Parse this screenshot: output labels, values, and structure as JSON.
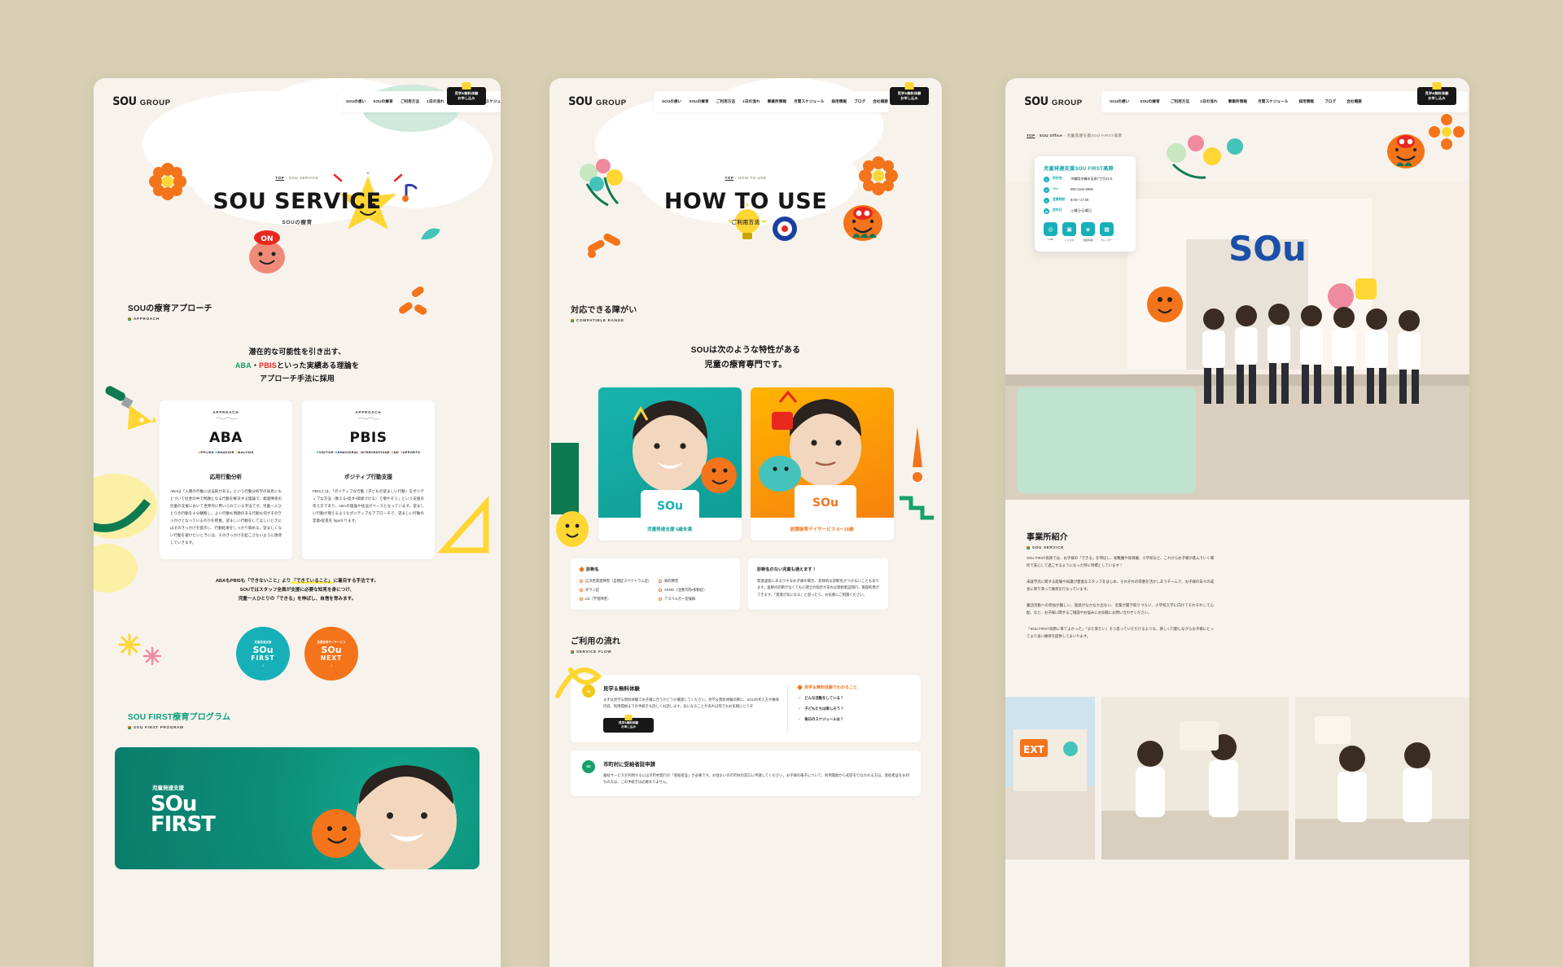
{
  "brand": {
    "name": "SOU",
    "suffix": "GROUP"
  },
  "nav": {
    "items": [
      "SOUの想い",
      "SOUの療育",
      "ご利用方法",
      "1日の流れ",
      "事業所情報",
      "月間スケジュール",
      "採用情報",
      "ブログ",
      "会社概要"
    ],
    "cta_line1": "見学&無料体験",
    "cta_line2": "お申し込み"
  },
  "panel1": {
    "breadcrumb": {
      "top": "TOP",
      "sep": "›",
      "current": "SOU SERVICE"
    },
    "hero": {
      "title": "SOU SERVICE",
      "subtitle": "SOUの療育"
    },
    "section": {
      "title": "SOUの療育アプローチ",
      "en": "APPROACH"
    },
    "lead": {
      "line1": "潜在的な可能性を引き出す、",
      "line2_aba": "ABA",
      "line2_mid": "・",
      "line2_pbis": "PBIS",
      "line2_rest": "といった実績ある理論を",
      "line3": "アプローチ手法に採用"
    },
    "cards": [
      {
        "label": "APPROACH",
        "big": "ABA",
        "sub_parts": [
          "A",
          "PPLIED ",
          "B",
          "EHAVIOR ",
          "A",
          "NALYSIS"
        ],
        "title": "応用行動分析",
        "body": "ABAは「人間の行動には法則がある」という行動分析学の知見にもとづいて社会の中で問題となる行動を解決する理論で、発達障害の児童の支援において世界的に用いられている手法です。児童一人ひとりの行動を十分観察し、よい行動も問題のある行動も何がそのきっかけとなっているのかを把握。望ましい行動をしてほしいときにはそのきっかけを提示し、行動結果をしっかり褒める。望ましくない行動を避けたいときには、そのきっかけを起こさないように誘導していきます。"
      },
      {
        "label": "APPROACH",
        "big": "PBIS",
        "sub_parts": [
          "P",
          "OSITIVE ",
          "B",
          "EHAVIORAL ",
          "I",
          "NTERVENTIONS ",
          "A",
          "ND ",
          "S",
          "UPPORTS"
        ],
        "title": "ポジティブ行動支援",
        "body": "PBISとは、「ポジティブな行動（子どもの望ましい行動）をポジティブな方法（教える・促す・価値づける）で増やそう」という支援の考え方であり、ABAの理論や技法がベースとなっています。望ましい行動が増えるようなポジティブなアプローチで、望ましい行動の定着・促進を figurd ります。"
      }
    ],
    "closing": {
      "line1_a": "ABAもPBISも「できないこと」より",
      "line1_mark": "「できていること」",
      "line1_b": "に着目する手法です。",
      "line2": "SOUではスタッフ全員が支援に必要な知見を身につけ、",
      "line3": "児童一人ひとりの「できる」を伸ばし、自信を育みます。"
    },
    "circles": [
      {
        "cap": "児童発達支援",
        "name": "SOu",
        "name2": "FIRST",
        "arrow": "↓",
        "color": "#17b0b8"
      },
      {
        "cap": "放課後等デイサービス",
        "name": "SOu",
        "name2": "NEXT",
        "arrow": "↓",
        "color": "#f4741b"
      }
    ],
    "program": {
      "title": "SOU FIRST療育プログラム",
      "en": "SOU FIRST PROGRAM",
      "banner_small": "児童発達支援",
      "banner_big": "SOu",
      "banner_big2": "FIRST"
    }
  },
  "panel2": {
    "breadcrumb": {
      "top": "TOP",
      "sep": "›",
      "current": "HOW TO USE"
    },
    "hero": {
      "title": "HOW TO USE",
      "subtitle": "ご利用方法"
    },
    "section": {
      "title": "対応できる障がい",
      "en": "COMPATIBLE RANGE"
    },
    "lead": {
      "line1": "SOUは次のような特性がある",
      "line2": "児童の療育専門です。"
    },
    "photo_cards": [
      {
        "caption": "児童発達支援 6歳未満",
        "color": "teal"
      },
      {
        "caption": "放課後等デイサービス 6〜18歳",
        "color": "orange"
      }
    ],
    "diagnosis": {
      "heading": "診断名",
      "items": [
        "広汎性発達障害（自閉症スペクトラム症）",
        "知的障害",
        "ダウン症",
        "ADHD（注意欠陥・多動症）",
        "LD（学習障害）",
        "アスペルガー症候群"
      ]
    },
    "note": {
      "heading": "診断名のない児童も通えます！",
      "body": "発達過程にあるウチなお子様の場合、具体的な診断名がつかないこともあります。医師の診断がなくても心理士の指示があれば受給者証発行、施設利用ができます。「発達が気になる」と思ったら、お気軽にご相談ください。"
    },
    "flow_section": {
      "title": "ご利用の流れ",
      "en": "SERVICE FLOW"
    },
    "flow": [
      {
        "num": "01",
        "title": "見学＆無料体験",
        "body": "まずは見学＆無料体験でお子様に合うかどうか確認してください。見学＆無料体験の際に、SOUの考え方や療育内容、利用開始までの手続きも詳しくお話します。気になることがあれば何でもお気軽にどうぞ",
        "btn1": "見学&無料体験",
        "btn2": "お申し込み",
        "side_heading": "見学＆無料体験でわかること",
        "side_items": [
          "どんな活動をしている？",
          "子どもたちは楽しそう？",
          "毎日のスケジュールは？"
        ]
      },
      {
        "num": "02",
        "title": "市町村に受給者証申請",
        "body": "福祉サービスを利用するには市町村発行の「受給者証」が必要です。お住まいの市町村の窓口に申請してください。お子様の様子について、利用開始から初診を行なわれる方は、受給者証をお持ちの方は、この手続きは必要ありません。",
        "side_heading": "",
        "side_items": []
      }
    ]
  },
  "panel3": {
    "breadcrumb": {
      "top": "TOP",
      "sep": "›",
      "mid": "SOU Office",
      "sep2": "›",
      "current": "児童発達支援SOU FIRST高原"
    },
    "infocard": {
      "title": "児童発達支援SOU FIRST高原",
      "rows": [
        {
          "label": "所在地",
          "value": "沖縄県沖縄市高原7丁目21-5"
        },
        {
          "label": "TEL",
          "value": "050-1944-9996"
        },
        {
          "label": "営業時間",
          "value": "8:00〜17:00"
        },
        {
          "label": "定休日",
          "value": "土曜日・日曜日"
        }
      ],
      "sns": [
        {
          "icon": "◎",
          "label": "LINE"
        },
        {
          "icon": "▣",
          "label": "インスタ"
        },
        {
          "icon": "◈",
          "label": "地図情報"
        },
        {
          "icon": "▦",
          "label": "カレンダー"
        }
      ]
    },
    "section": {
      "title": "事業所紹介",
      "en": "SOU SERVICE"
    },
    "paragraphs": [
      "SOU FIRST高原では、お子様の「できる」を伸ばし、幼稚園や保育園、小学校など、これからお子様が進んでいく場所で安心して過ごせるようになった時に目標としています！",
      "未就学児に関する経験や知識が豊富なスタッフをはじめ、それぞれの得意を活かしあうチームで、お子様の日々の成長に寄り添って療育を行なっています。",
      "集団活動への参加が難しい、発語がなかなか出ない、言葉が聞き取りづらい、小学校入学に向けてそわそわして心配、など、お子様に関するご相談やお悩みにお気軽にお問い合わせください。",
      "「SOU FIRST高原に来てよかった」「また来たい」そう思っていただけるような、楽しく行動しながらお子様にとってより良い療育を提供してまいります。"
    ]
  }
}
